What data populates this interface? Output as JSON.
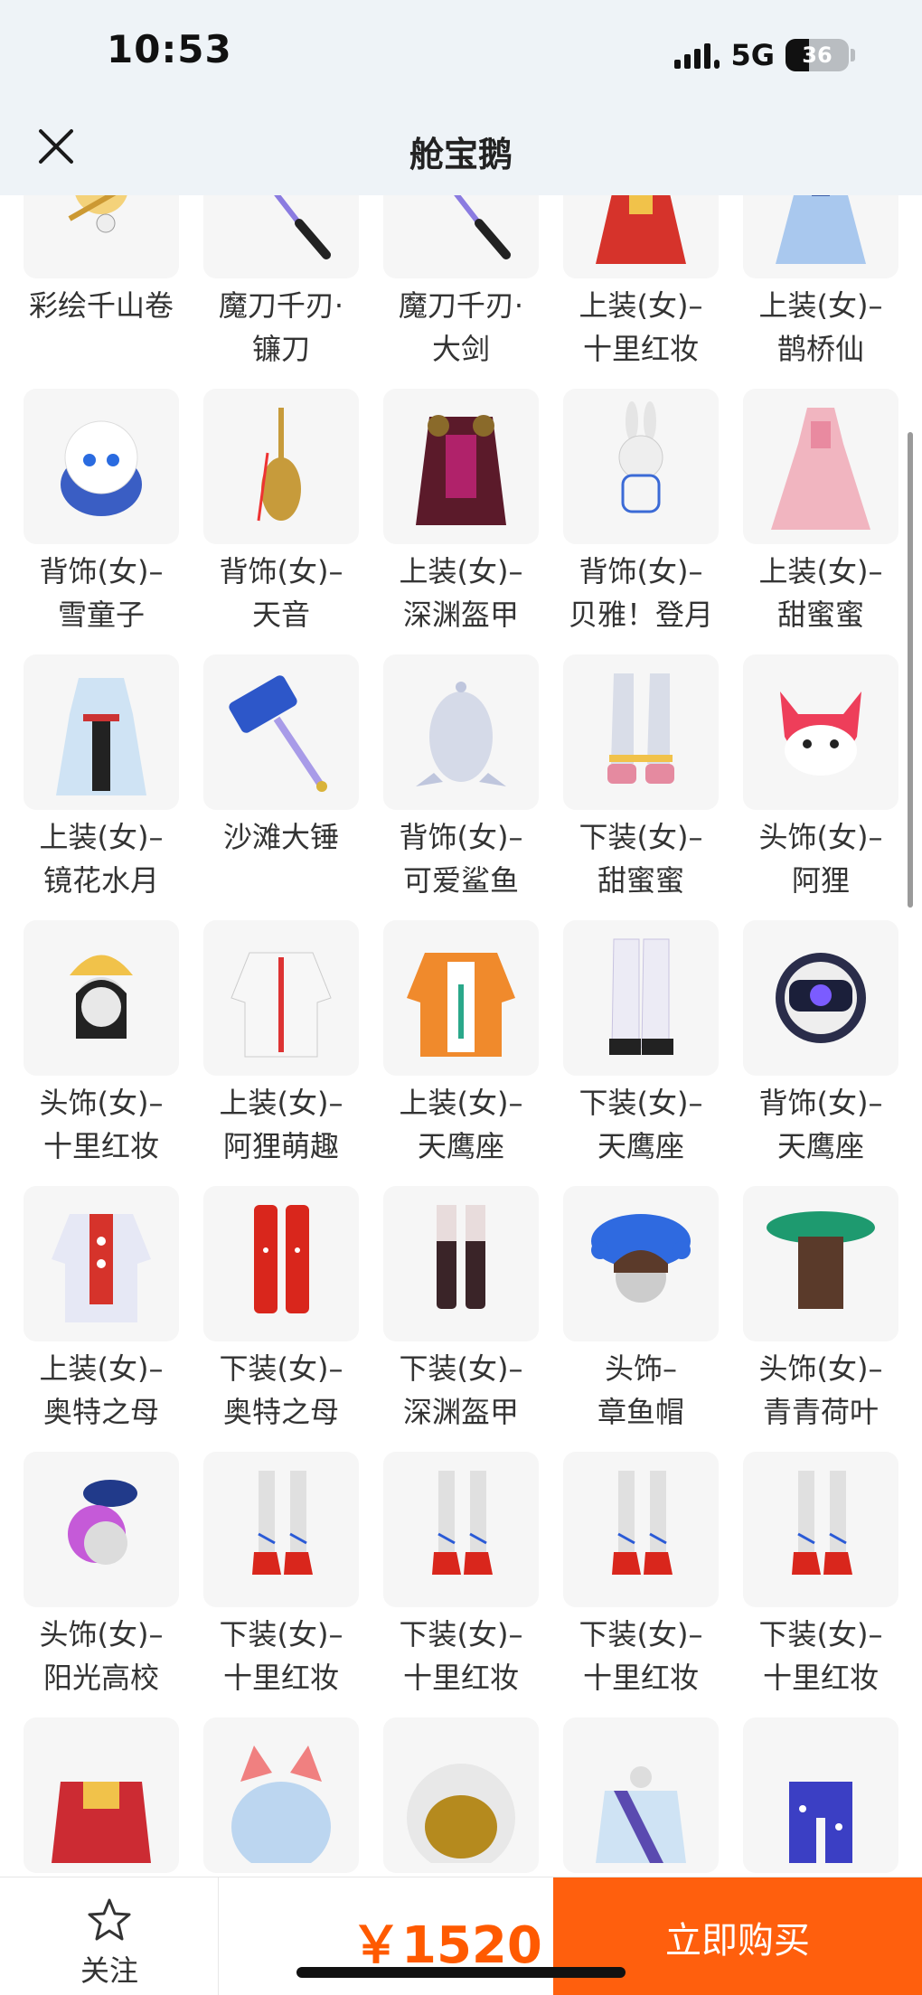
{
  "status_bar": {
    "time": "10:53",
    "network": "5G",
    "battery": "36"
  },
  "header": {
    "title": "舱宝鹅",
    "close_icon": "close-icon"
  },
  "items": [
    {
      "label": "彩绘千山卷",
      "icon": "painted-scroll-icon"
    },
    {
      "label": "魔刀千刃·镰刀",
      "icon": "purple-scythe-icon"
    },
    {
      "label": "魔刀千刃·大剑",
      "icon": "purple-sword-icon"
    },
    {
      "label": "上装(女)–十里红妆",
      "icon": "red-wedding-dress-icon"
    },
    {
      "label": "上装(女)–鹊桥仙",
      "icon": "blue-dress-icon"
    },
    {
      "label": "背饰(女)–雪童子",
      "icon": "snow-spirit-icon"
    },
    {
      "label": "背饰(女)–天音",
      "icon": "lute-icon"
    },
    {
      "label": "上装(女)–深渊盔甲",
      "icon": "abyss-armor-icon"
    },
    {
      "label": "背饰(女)–贝雅！登月",
      "icon": "astronaut-bunny-icon"
    },
    {
      "label": "上装(女)–甜蜜蜜",
      "icon": "pink-dress-icon"
    },
    {
      "label": "上装(女)–镜花水月",
      "icon": "kimono-icon"
    },
    {
      "label": "沙滩大锤",
      "icon": "beach-hammer-icon"
    },
    {
      "label": "背饰(女)–可爱鲨鱼",
      "icon": "shark-icon"
    },
    {
      "label": "下装(女)–甜蜜蜜",
      "icon": "white-boots-icon"
    },
    {
      "label": "头饰(女)–阿狸",
      "icon": "fox-head-icon"
    },
    {
      "label": "头饰(女)–十里红妆",
      "icon": "bridal-headdress-icon"
    },
    {
      "label": "上装(女)–阿狸萌趣",
      "icon": "white-hoodie-icon"
    },
    {
      "label": "上装(女)–天鹰座",
      "icon": "orange-jacket-icon"
    },
    {
      "label": "下装(女)–天鹰座",
      "icon": "white-pants-icon"
    },
    {
      "label": "背饰(女)–天鹰座",
      "icon": "robot-backpack-icon"
    },
    {
      "label": "上装(女)–奥特之母",
      "icon": "red-silver-suit-icon"
    },
    {
      "label": "下装(女)–奥特之母",
      "icon": "red-boots-icon"
    },
    {
      "label": "下装(女)–深渊盔甲",
      "icon": "dark-leggings-icon"
    },
    {
      "label": "头饰–章鱼帽",
      "icon": "octopus-hat-icon"
    },
    {
      "label": "头饰(女)–青青荷叶",
      "icon": "lotus-leaf-hat-icon"
    },
    {
      "label": "头饰(女)–阳光高校",
      "icon": "purple-hair-beret-icon"
    },
    {
      "label": "下装(女)–十里红妆",
      "icon": "red-heels-icon"
    },
    {
      "label": "下装(女)–十里红妆",
      "icon": "red-heels-icon"
    },
    {
      "label": "下装(女)–十里红妆",
      "icon": "red-heels-icon"
    },
    {
      "label": "下装(女)–十里红妆",
      "icon": "red-heels-icon"
    },
    {
      "label": "",
      "icon": "red-kimono-icon"
    },
    {
      "label": "",
      "icon": "cat-ear-hair-icon"
    },
    {
      "label": "",
      "icon": "gold-helmet-icon"
    },
    {
      "label": "",
      "icon": "blue-sash-icon"
    },
    {
      "label": "",
      "icon": "star-pants-icon"
    }
  ],
  "bottom_bar": {
    "follow_label": "关注",
    "price": "￥1520",
    "buy_label": "立即购买"
  },
  "colors": {
    "accent": "#ff5f0d",
    "price": "#ff5a00",
    "header_bg": "#eef3f7"
  }
}
